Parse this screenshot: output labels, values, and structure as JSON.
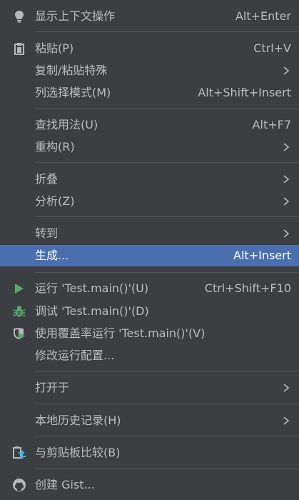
{
  "menu": {
    "show_context_actions": {
      "label": "显示上下文操作",
      "shortcut": "Alt+Enter",
      "icon": "lightbulb-icon"
    },
    "paste": {
      "label": "粘贴(P)",
      "shortcut": "Ctrl+V",
      "icon": "clipboard-icon"
    },
    "copy_paste_special": {
      "label": "复制/粘贴特殊"
    },
    "column_selection_mode": {
      "label": "列选择模式(M)",
      "shortcut": "Alt+Shift+Insert"
    },
    "find_usages": {
      "label": "查找用法(U)",
      "shortcut": "Alt+F7"
    },
    "refactor": {
      "label": "重构(R)"
    },
    "folding": {
      "label": "折叠"
    },
    "analyze": {
      "label": "分析(Z)"
    },
    "goto": {
      "label": "转到"
    },
    "generate": {
      "label": "生成...",
      "shortcut": "Alt+Insert"
    },
    "run": {
      "label": "运行 'Test.main()'(U)",
      "shortcut": "Ctrl+Shift+F10",
      "icon": "run-icon"
    },
    "debug": {
      "label": "调试 'Test.main()'(D)",
      "icon": "debug-bug-icon"
    },
    "run_coverage": {
      "label": "使用覆盖率运行  'Test.main()'(V)",
      "icon": "coverage-shield-icon"
    },
    "modify_run_config": {
      "label": "修改运行配置..."
    },
    "open_in": {
      "label": "打开于"
    },
    "local_history": {
      "label": "本地历史记录(H)"
    },
    "compare_clipboard": {
      "label": "与剪贴板比较(B)",
      "icon": "compare-clipboard-icon"
    },
    "create_gist": {
      "label": "创建 Gist...",
      "icon": "github-icon"
    }
  },
  "colors": {
    "background": "#3c3f41",
    "selection": "#4b6eaf",
    "text": "#bbbbbb",
    "run_green": "#59a869"
  }
}
